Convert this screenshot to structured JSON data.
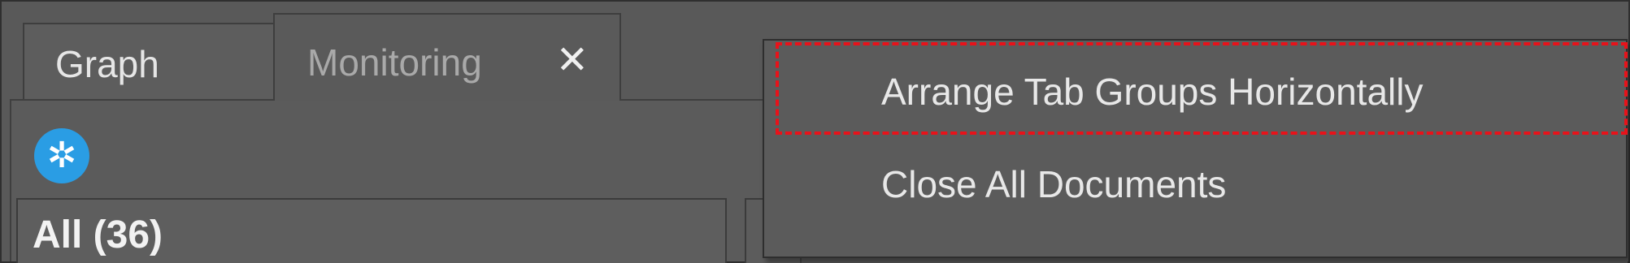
{
  "tabs": [
    {
      "label": "Graph",
      "active": false
    },
    {
      "label": "Monitoring",
      "active": true,
      "close_icon": "close-icon"
    }
  ],
  "toolbar": {
    "settings_icon": "gear-icon"
  },
  "left_panel": {
    "label": "All (36)"
  },
  "context_menu": {
    "items": [
      {
        "label": "Arrange Tab Groups Horizontally",
        "highlighted": true
      },
      {
        "label": "Close All Documents",
        "highlighted": false
      }
    ]
  },
  "colors": {
    "background": "#595959",
    "highlight_border": "#e8121a",
    "gear_blue": "#2a9de4",
    "text": "#e8e8e8"
  }
}
